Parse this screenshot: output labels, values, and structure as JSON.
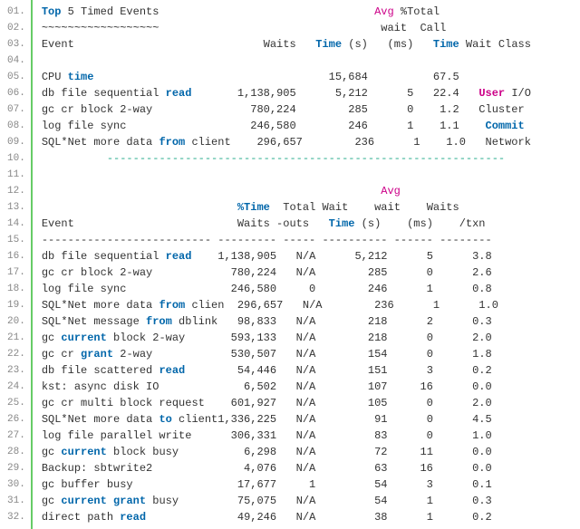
{
  "title": "Top 5 Timed Events",
  "header1": {
    "avg": "Avg",
    "pct_total": "%Total"
  },
  "header2": {
    "wait": "wait",
    "call": "Call"
  },
  "header3": {
    "event": "Event",
    "waits": "Waits",
    "time_s": "Time (s)",
    "ms": "(ms)",
    "time": "Time",
    "wait_class": "Wait Class"
  },
  "section1_rows": [
    {
      "event": "CPU time",
      "waits": "",
      "time_s": "15,684",
      "ms": "",
      "call": "67.5",
      "class": ""
    },
    {
      "event": "db file sequential read",
      "waits": "1,138,905",
      "time_s": "5,212",
      "ms": "5",
      "call": "22.4",
      "class": "User I/O"
    },
    {
      "event": "gc cr block 2-way",
      "waits": "780,224",
      "time_s": "285",
      "ms": "0",
      "call": "1.2",
      "class": "Cluster"
    },
    {
      "event": "log file sync",
      "waits": "246,580",
      "time_s": "246",
      "ms": "1",
      "call": "1.1",
      "class": "Commit"
    },
    {
      "event": "SQL*Net more data from client",
      "waits": "296,657",
      "time_s": "236",
      "ms": "1",
      "call": "1.0",
      "class": "Network"
    }
  ],
  "header4": {
    "avg": "Avg"
  },
  "header5": {
    "pct_time": "%Time",
    "total_wait": "Total Wait",
    "wait": "wait",
    "waits": "Waits"
  },
  "header6": {
    "event": "Event",
    "waits": "Waits",
    "outs": "-outs",
    "time_s": "Time (s)",
    "ms": "(ms)",
    "txn": "/txn"
  },
  "section2_rows": [
    {
      "event": "db file sequential read",
      "waits": "1,138,905",
      "outs": "N/A",
      "time_s": "5,212",
      "ms": "5",
      "txn": "3.8"
    },
    {
      "event": "gc cr block 2-way",
      "waits": "780,224",
      "outs": "N/A",
      "time_s": "285",
      "ms": "0",
      "txn": "2.6"
    },
    {
      "event": "log file sync",
      "waits": "246,580",
      "outs": "0",
      "time_s": "246",
      "ms": "1",
      "txn": "0.8"
    },
    {
      "event": "SQL*Net more data from clien",
      "waits": "296,657",
      "outs": "N/A",
      "time_s": "236",
      "ms": "1",
      "txn": "1.0"
    },
    {
      "event": "SQL*Net message from dblink",
      "waits": "98,833",
      "outs": "N/A",
      "time_s": "218",
      "ms": "2",
      "txn": "0.3"
    },
    {
      "event": "gc current block 2-way",
      "waits": "593,133",
      "outs": "N/A",
      "time_s": "218",
      "ms": "0",
      "txn": "2.0"
    },
    {
      "event": "gc cr grant 2-way",
      "waits": "530,507",
      "outs": "N/A",
      "time_s": "154",
      "ms": "0",
      "txn": "1.8"
    },
    {
      "event": "db file scattered read",
      "waits": "54,446",
      "outs": "N/A",
      "time_s": "151",
      "ms": "3",
      "txn": "0.2"
    },
    {
      "event": "kst: async disk IO",
      "waits": "6,502",
      "outs": "N/A",
      "time_s": "107",
      "ms": "16",
      "txn": "0.0"
    },
    {
      "event": "gc cr multi block request",
      "waits": "601,927",
      "outs": "N/A",
      "time_s": "105",
      "ms": "0",
      "txn": "2.0"
    },
    {
      "event": "SQL*Net more data to client",
      "waits": "1,336,225",
      "outs": "N/A",
      "time_s": "91",
      "ms": "0",
      "txn": "4.5"
    },
    {
      "event": "log file parallel write",
      "waits": "306,331",
      "outs": "N/A",
      "time_s": "83",
      "ms": "0",
      "txn": "1.0"
    },
    {
      "event": "gc current block busy",
      "waits": "6,298",
      "outs": "N/A",
      "time_s": "72",
      "ms": "11",
      "txn": "0.0"
    },
    {
      "event": "Backup: sbtwrite2",
      "waits": "4,076",
      "outs": "N/A",
      "time_s": "63",
      "ms": "16",
      "txn": "0.0"
    },
    {
      "event": "gc buffer busy",
      "waits": "17,677",
      "outs": "1",
      "time_s": "54",
      "ms": "3",
      "txn": "0.1"
    },
    {
      "event": "gc current grant busy",
      "waits": "75,075",
      "outs": "N/A",
      "time_s": "54",
      "ms": "1",
      "txn": "0.3"
    },
    {
      "event": "direct path read",
      "waits": "49,246",
      "outs": "N/A",
      "time_s": "38",
      "ms": "1",
      "txn": "0.2"
    }
  ],
  "chart_data": {
    "type": "table",
    "title": "Top 5 Timed Events / Wait Events",
    "tables": [
      {
        "columns": [
          "Event",
          "Waits",
          "Time (s)",
          "Avg wait (ms)",
          "%Total Call Time",
          "Wait Class"
        ],
        "rows": [
          [
            "CPU time",
            null,
            15684,
            null,
            67.5,
            null
          ],
          [
            "db file sequential read",
            1138905,
            5212,
            5,
            22.4,
            "User I/O"
          ],
          [
            "gc cr block 2-way",
            780224,
            285,
            0,
            1.2,
            "Cluster"
          ],
          [
            "log file sync",
            246580,
            246,
            1,
            1.1,
            "Commit"
          ],
          [
            "SQL*Net more data from client",
            296657,
            236,
            1,
            1.0,
            "Network"
          ]
        ]
      },
      {
        "columns": [
          "Event",
          "Waits",
          "%Time -outs",
          "Total Wait Time (s)",
          "Avg wait (ms)",
          "Waits /txn"
        ],
        "rows": [
          [
            "db file sequential read",
            1138905,
            "N/A",
            5212,
            5,
            3.8
          ],
          [
            "gc cr block 2-way",
            780224,
            "N/A",
            285,
            0,
            2.6
          ],
          [
            "log file sync",
            246580,
            0,
            246,
            1,
            0.8
          ],
          [
            "SQL*Net more data from clien",
            296657,
            "N/A",
            236,
            1,
            1.0
          ],
          [
            "SQL*Net message from dblink",
            98833,
            "N/A",
            218,
            2,
            0.3
          ],
          [
            "gc current block 2-way",
            593133,
            "N/A",
            218,
            0,
            2.0
          ],
          [
            "gc cr grant 2-way",
            530507,
            "N/A",
            154,
            0,
            1.8
          ],
          [
            "db file scattered read",
            54446,
            "N/A",
            151,
            3,
            0.2
          ],
          [
            "kst: async disk IO",
            6502,
            "N/A",
            107,
            16,
            0.0
          ],
          [
            "gc cr multi block request",
            601927,
            "N/A",
            105,
            0,
            2.0
          ],
          [
            "SQL*Net more data to client",
            1336225,
            "N/A",
            91,
            0,
            4.5
          ],
          [
            "log file parallel write",
            306331,
            "N/A",
            83,
            0,
            1.0
          ],
          [
            "gc current block busy",
            6298,
            "N/A",
            72,
            11,
            0.0
          ],
          [
            "Backup: sbtwrite2",
            4076,
            "N/A",
            63,
            16,
            0.0
          ],
          [
            "gc buffer busy",
            17677,
            1,
            54,
            3,
            0.1
          ],
          [
            "gc current grant busy",
            75075,
            "N/A",
            54,
            1,
            0.3
          ],
          [
            "direct path read",
            49246,
            "N/A",
            38,
            1,
            0.2
          ]
        ]
      }
    ]
  }
}
